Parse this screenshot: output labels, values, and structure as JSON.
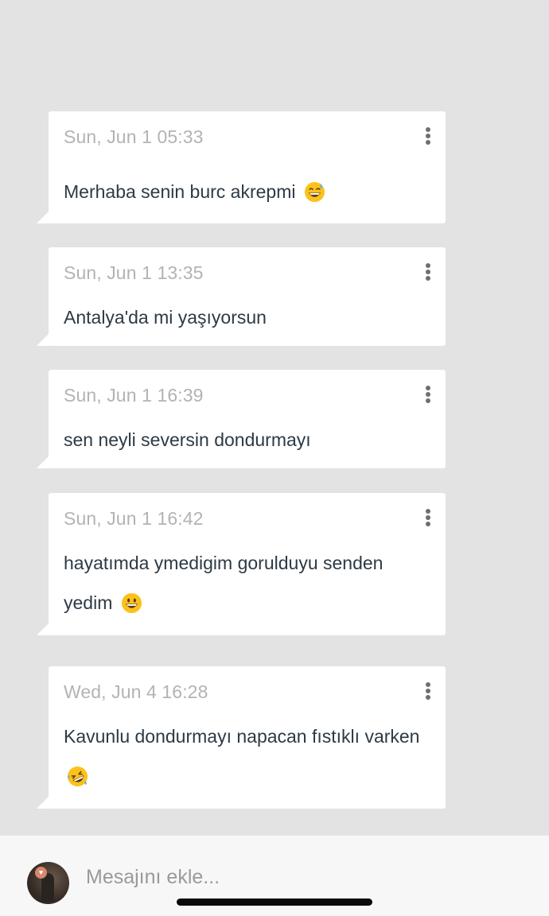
{
  "messages": [
    {
      "time": "Sun, Jun 1 05:33",
      "text": "Merhaba senin burc akrepmi",
      "emoji": "grinning-sweat-emoji"
    },
    {
      "time": "Sun, Jun 1 13:35",
      "text": "Antalya'da mi yaşıyorsun",
      "emoji": ""
    },
    {
      "time": "Sun, Jun 1 16:39",
      "text": "sen neyli seversin dondurmayı",
      "emoji": ""
    },
    {
      "time": "Sun, Jun 1 16:42",
      "text": "hayatımda ymedigim gorulduyu senden yedim",
      "emoji": "grinning-face-emoji"
    },
    {
      "time": "Wed, Jun 4 16:28",
      "text": "Kavunlu dondurmayı napacan fıstıklı varken",
      "emoji": "rolling-laughing-emoji"
    }
  ],
  "composer": {
    "placeholder": "Mesajını ekle...",
    "avatar_icon": "user-avatar-heart-badge"
  },
  "colors": {
    "background": "#e3e3e3",
    "bubble": "#ffffff",
    "timestamp": "#b3b3b3",
    "message_text": "#2d3a45",
    "menu_dots": "#6f6f6f"
  }
}
